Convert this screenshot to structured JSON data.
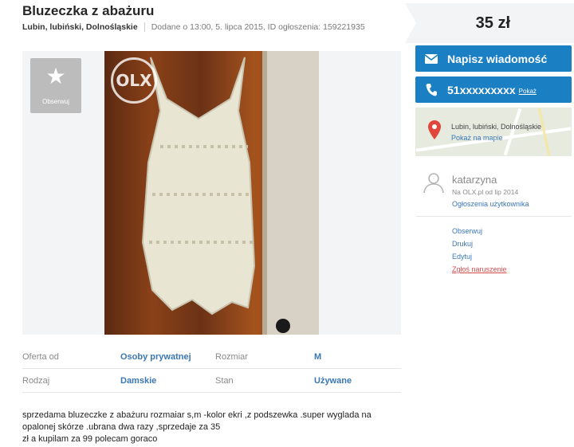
{
  "ad": {
    "title": "Bluzeczka z abażuru",
    "location": "Lubin, lubiński, Dolnośląskie",
    "added": "Dodane o 13:00, 5. lipca 2015, ID ogłoszenia: 159221935",
    "description": "sprzedama bluzeczke z abażuru rozmaiar s,m -kolor ekri ,z podszewka .super wyglada na\nopalonej skórze .ubrana dwa razy ,sprzedaje za 35\nzł a kupilam za 99 polecam goraco"
  },
  "gallery": {
    "observe_label": "Obserwuj",
    "watermark": "OLX"
  },
  "params": [
    {
      "k1": "Oferta od",
      "v1": "Osoby prywatnej",
      "k2": "Rozmiar",
      "v2": "M"
    },
    {
      "k1": "Rodzaj",
      "v1": "Damskie",
      "k2": "Stan",
      "v2": "Używane"
    }
  ],
  "sidebar": {
    "price": "35 zł",
    "message_button": "Napisz wiadomość",
    "phone": "51xxxxxxxxx",
    "phone_show": "Pokaż",
    "map_location": "Lubin, lubiński, Dolnośląskie",
    "map_link": "Pokaż na mapie",
    "user_name": "katarzyna",
    "user_since": "Na OLX.pl od lip 2014",
    "user_ads": "Ogłoszenia użytkownika",
    "actions": [
      "Obserwuj",
      "Drukuj",
      "Edytuj",
      "Zgłoś naruszenie"
    ]
  },
  "colors": {
    "accent": "#1b7fc4",
    "link": "#3a77b5",
    "report": "#d74d4d"
  },
  "icons": [
    "star-icon",
    "envelope-icon",
    "phone-icon",
    "map-pin-icon",
    "user-avatar-icon"
  ]
}
